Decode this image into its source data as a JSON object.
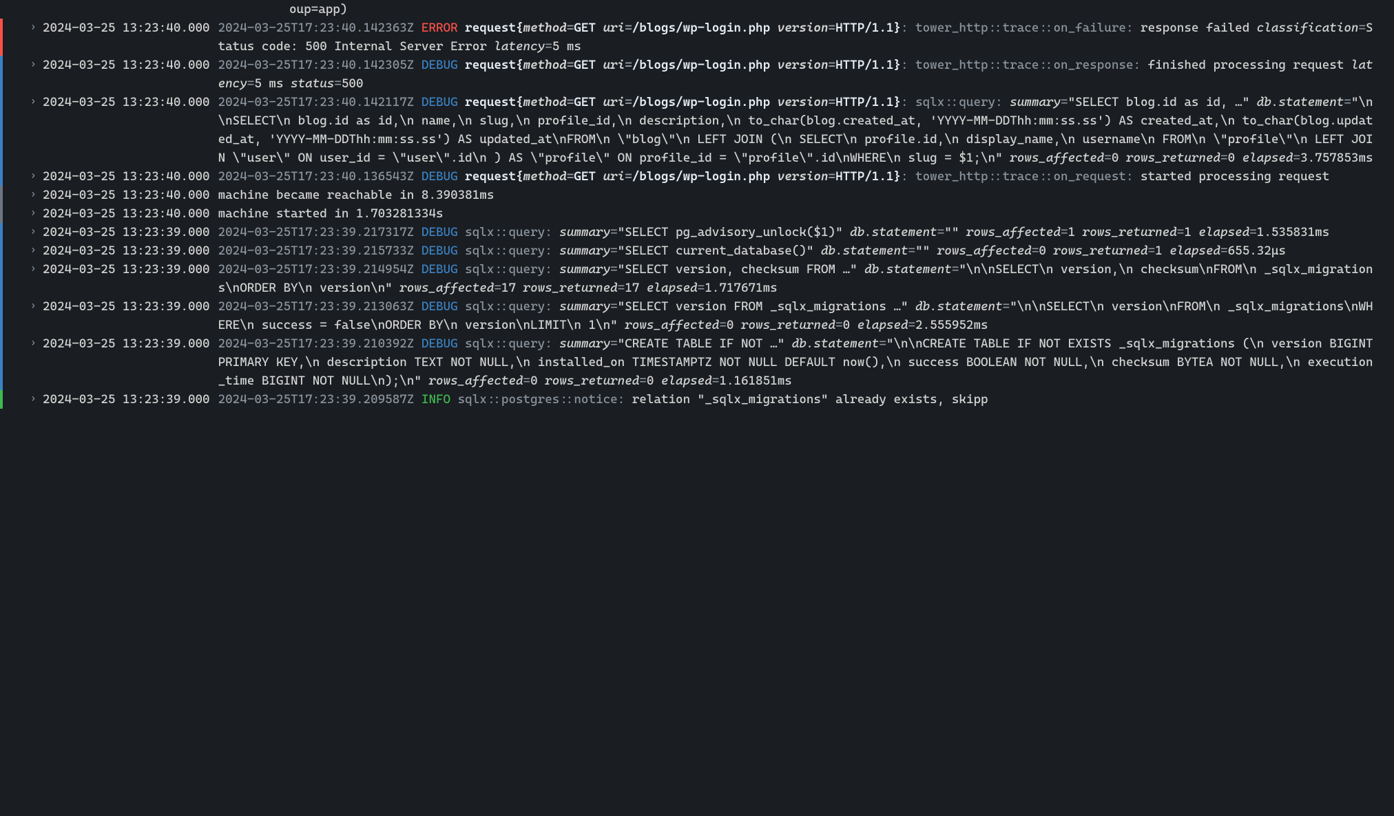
{
  "partial_top": "oup=app)",
  "entries": [
    {
      "bar": "error-entry",
      "chevron": true,
      "ts": "2024-03-25 13:23:40.000",
      "iso": "2024-03-25T17:23:40.142363Z",
      "level": "ERROR",
      "level_class": "level-error",
      "has_request": true,
      "method": "GET",
      "uri": "/blogs/wp-login.php",
      "version": "HTTP/1.1",
      "after_span": ": tower_http::trace::on_failure: ",
      "msg": "response failed ",
      "kv": [
        {
          "k": "classification",
          "v": "Status code: 500 Internal Server Error "
        },
        {
          "k": "latency",
          "v": "5 ms"
        }
      ]
    },
    {
      "bar": "debug-entry",
      "chevron": true,
      "ts": "2024-03-25 13:23:40.000",
      "iso": "2024-03-25T17:23:40.142305Z",
      "level": "DEBUG",
      "level_class": "level-debug",
      "has_request": true,
      "method": "GET",
      "uri": "/blogs/wp-login.php",
      "version": "HTTP/1.1",
      "after_span": ": tower_http::trace::on_response: ",
      "msg": "finished processing request ",
      "kv": [
        {
          "k": "latency",
          "v": "5 ms "
        },
        {
          "k": "status",
          "v": "500"
        }
      ]
    },
    {
      "bar": "debug-entry",
      "chevron": true,
      "ts": "2024-03-25 13:23:40.000",
      "iso": "2024-03-25T17:23:40.142117Z",
      "level": "DEBUG",
      "level_class": "level-debug",
      "has_request": true,
      "method": "GET",
      "uri": "/blogs/wp-login.php",
      "version": "HTTP/1.1",
      "after_span": ": sqlx::query: ",
      "msg": "",
      "kv": [
        {
          "k": "summary",
          "v": "\"SELECT blog.id as id, …\" "
        },
        {
          "k": "db.statement",
          "v": "\"\\n\\nSELECT\\n  blog.id as id,\\n  name,\\n  slug,\\n  profile_id,\\n  description,\\n  to_char(blog.created_at, 'YYYY-MM-DDThh:mm:ss.ss') AS created_at,\\n  to_char(blog.updated_at, 'YYYY-MM-DDThh:mm:ss.ss') AS updated_at\\nFROM\\n  \\\"blog\\\"\\n  LEFT JOIN (\\n    SELECT\\n      profile.id,\\n      display_name,\\n      username\\n    FROM\\n      \\\"profile\\\"\\n      LEFT JOIN \\\"user\\\" ON user_id = \\\"user\\\".id\\n  ) AS \\\"profile\\\" ON profile_id = \\\"profile\\\".id\\nWHERE\\n  slug = $1;\\n\" "
        },
        {
          "k": "rows_affected",
          "v": "0 "
        },
        {
          "k": "rows_returned",
          "v": "0 "
        },
        {
          "k": "elapsed",
          "v": "3.757853ms"
        }
      ]
    },
    {
      "bar": "debug-entry",
      "chevron": true,
      "ts": "2024-03-25 13:23:40.000",
      "iso": "2024-03-25T17:23:40.136543Z",
      "level": "DEBUG",
      "level_class": "level-debug",
      "has_request": true,
      "method": "GET",
      "uri": "/blogs/wp-login.php",
      "version": "HTTP/1.1",
      "after_span": ": tower_http::trace::on_request: ",
      "msg": "started processing request",
      "kv": []
    },
    {
      "bar": "neutral-entry",
      "chevron": true,
      "ts": "2024-03-25 13:23:40.000",
      "plain": "machine became reachable in 8.390381ms"
    },
    {
      "bar": "neutral-entry",
      "chevron": true,
      "ts": "2024-03-25 13:23:40.000",
      "plain": "machine started in 1.703281334s"
    },
    {
      "bar": "debug-entry",
      "chevron": true,
      "ts": "2024-03-25 13:23:39.000",
      "iso": "2024-03-25T17:23:39.217317Z",
      "level": "DEBUG",
      "level_class": "level-debug",
      "has_request": false,
      "after_span": " sqlx::query: ",
      "msg": "",
      "kv": [
        {
          "k": "summary",
          "v": "\"SELECT pg_advisory_unlock($1)\" "
        },
        {
          "k": "db.statement",
          "v": "\"\" "
        },
        {
          "k": "rows_affected",
          "v": "1 "
        },
        {
          "k": "rows_returned",
          "v": "1 "
        },
        {
          "k": "elapsed",
          "v": "1.535831ms"
        }
      ]
    },
    {
      "bar": "debug-entry",
      "chevron": true,
      "ts": "2024-03-25 13:23:39.000",
      "iso": "2024-03-25T17:23:39.215733Z",
      "level": "DEBUG",
      "level_class": "level-debug",
      "has_request": false,
      "after_span": " sqlx::query: ",
      "msg": "",
      "kv": [
        {
          "k": "summary",
          "v": "\"SELECT current_database()\" "
        },
        {
          "k": "db.statement",
          "v": "\"\" "
        },
        {
          "k": "rows_affected",
          "v": "0 "
        },
        {
          "k": "rows_returned",
          "v": "1 "
        },
        {
          "k": "elapsed",
          "v": "655.32µs"
        }
      ]
    },
    {
      "bar": "debug-entry",
      "chevron": true,
      "ts": "2024-03-25 13:23:39.000",
      "iso": "2024-03-25T17:23:39.214954Z",
      "level": "DEBUG",
      "level_class": "level-debug",
      "has_request": false,
      "after_span": " sqlx::query: ",
      "msg": "",
      "kv": [
        {
          "k": "summary",
          "v": "\"SELECT version, checksum FROM …\" "
        },
        {
          "k": "db.statement",
          "v": "\"\\n\\nSELECT\\n  version,\\n  checksum\\nFROM\\n  _sqlx_migrations\\nORDER BY\\n  version\\n\" "
        },
        {
          "k": "rows_affected",
          "v": "17 "
        },
        {
          "k": "rows_returned",
          "v": "17 "
        },
        {
          "k": "elapsed",
          "v": "1.717671ms"
        }
      ]
    },
    {
      "bar": "debug-entry",
      "chevron": true,
      "ts": "2024-03-25 13:23:39.000",
      "iso": "2024-03-25T17:23:39.213063Z",
      "level": "DEBUG",
      "level_class": "level-debug",
      "has_request": false,
      "after_span": " sqlx::query: ",
      "msg": "",
      "kv": [
        {
          "k": "summary",
          "v": "\"SELECT version FROM _sqlx_migrations …\" "
        },
        {
          "k": "db.statement",
          "v": "\"\\n\\nSELECT\\n  version\\nFROM\\n  _sqlx_migrations\\nWHERE\\n  success = false\\nORDER BY\\n  version\\nLIMIT\\n  1\\n\" "
        },
        {
          "k": "rows_affected",
          "v": "0 "
        },
        {
          "k": "rows_returned",
          "v": "0 "
        },
        {
          "k": "elapsed",
          "v": "2.555952ms"
        }
      ]
    },
    {
      "bar": "debug-entry",
      "chevron": true,
      "ts": "2024-03-25 13:23:39.000",
      "iso": "2024-03-25T17:23:39.210392Z",
      "level": "DEBUG",
      "level_class": "level-debug",
      "has_request": false,
      "after_span": " sqlx::query: ",
      "msg": "",
      "kv": [
        {
          "k": "summary",
          "v": "\"CREATE TABLE IF NOT …\" "
        },
        {
          "k": "db.statement",
          "v": "\"\\n\\nCREATE TABLE IF NOT EXISTS _sqlx_migrations (\\n  version BIGINT PRIMARY KEY,\\n  description TEXT NOT NULL,\\n  installed_on TIMESTAMPTZ NOT NULL DEFAULT now(),\\n  success BOOLEAN NOT NULL,\\n  checksum BYTEA NOT NULL,\\n  execution_time BIGINT NOT NULL\\n);\\n\" "
        },
        {
          "k": "rows_affected",
          "v": "0 "
        },
        {
          "k": "rows_returned",
          "v": "0 "
        },
        {
          "k": "elapsed",
          "v": "1.161851ms"
        }
      ]
    },
    {
      "bar": "info-entry",
      "chevron": true,
      "ts": "2024-03-25 13:23:39.000",
      "iso": "2024-03-25T17:23:39.209587Z",
      "level": "INFO",
      "level_class": "level-info",
      "has_request": false,
      "after_span": " sqlx::postgres::notice: ",
      "msg": "relation \"_sqlx_migrations\" already exists, skipp",
      "kv": []
    }
  ]
}
